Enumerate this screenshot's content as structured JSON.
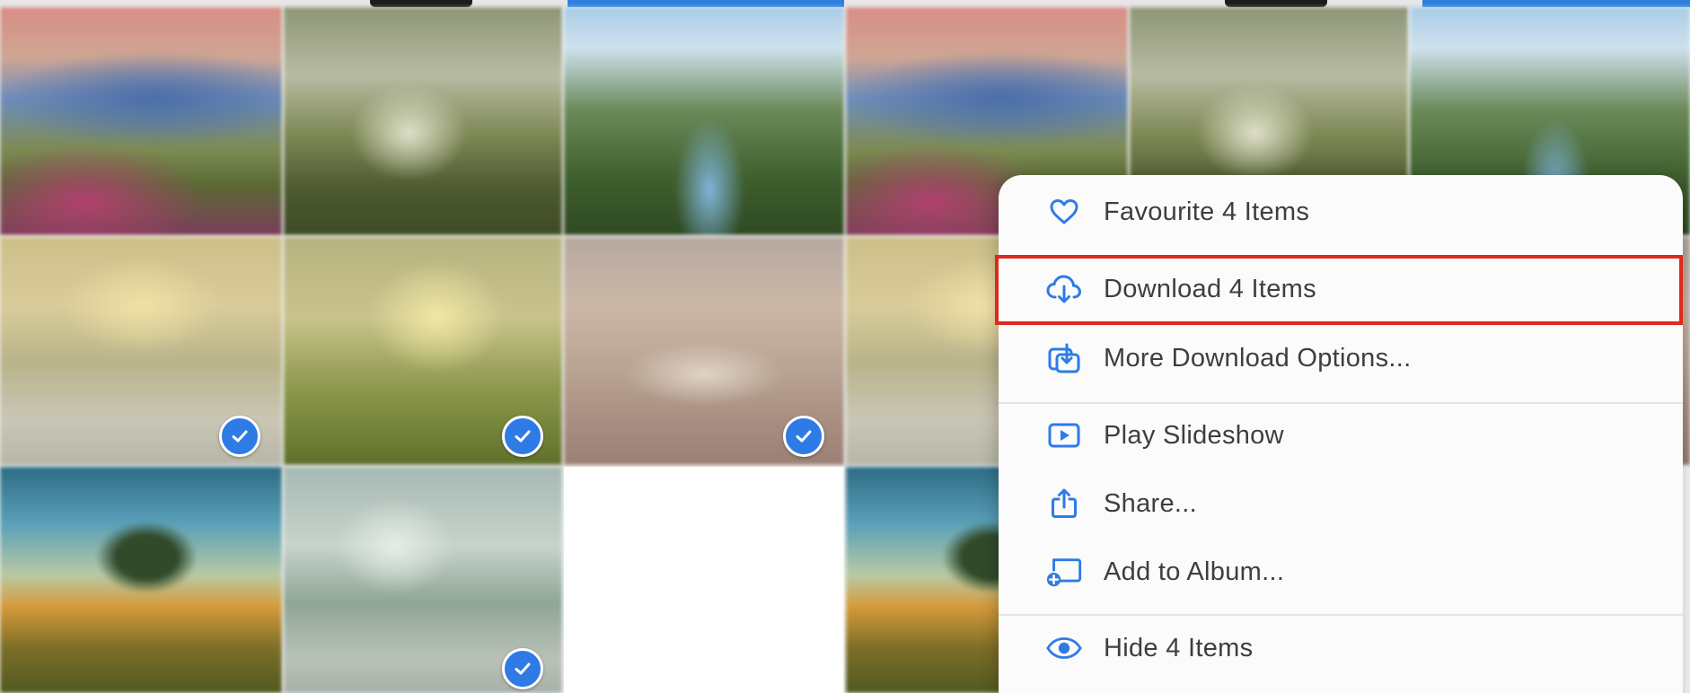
{
  "context_menu": {
    "items": [
      {
        "label": "Favourite 4 Items",
        "icon": "heart-icon"
      },
      {
        "label": "Download 4 Items",
        "icon": "cloud-download-icon",
        "highlighted": true
      },
      {
        "label": "More Download Options...",
        "icon": "download-options-icon"
      },
      {
        "label": "Play Slideshow",
        "icon": "slideshow-play-icon"
      },
      {
        "label": "Share...",
        "icon": "share-icon"
      },
      {
        "label": "Add to Album...",
        "icon": "add-to-album-icon"
      },
      {
        "label": "Hide 4 Items",
        "icon": "eye-icon"
      }
    ]
  },
  "photo_grid": {
    "selected_count": 4
  },
  "colors": {
    "accent": "#2e7be6",
    "highlight_border": "#e0281d",
    "menu_background": "#fbfbfb",
    "menu_text": "#3e3e3e"
  }
}
